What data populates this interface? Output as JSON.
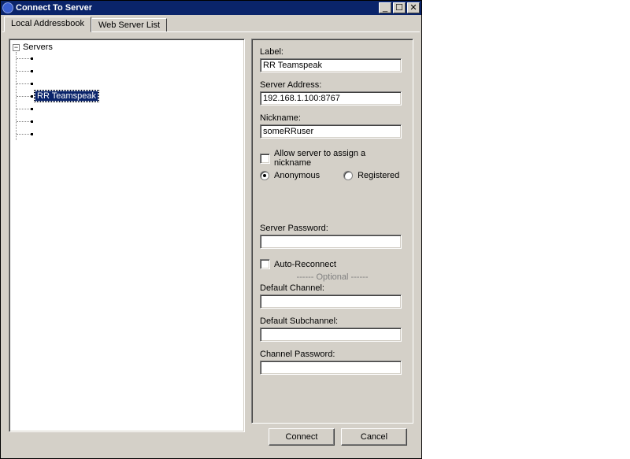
{
  "window": {
    "title": "Connect To Server"
  },
  "winbtns": {
    "min": "_",
    "max": "☐",
    "close": "✕"
  },
  "tabs": {
    "local": "Local Addressbook",
    "web": "Web Server List"
  },
  "tree": {
    "root": "Servers",
    "expander": "−",
    "selected": "RR Teamspeak"
  },
  "form": {
    "label_lbl": "Label:",
    "label_val": "RR Teamspeak",
    "addr_lbl": "Server Address:",
    "addr_val": "192.168.1.100:8767",
    "nick_lbl": "Nickname:",
    "nick_val": "someRRuser",
    "allow_assign": "Allow server to assign a nickname",
    "anon": "Anonymous",
    "reg": "Registered",
    "srvpwd_lbl": "Server Password:",
    "srvpwd_val": "",
    "autoreconnect": "Auto-Reconnect",
    "optional": "------ Optional ------",
    "defch_lbl": "Default Channel:",
    "defch_val": "",
    "defsub_lbl": "Default Subchannel:",
    "defsub_val": "",
    "chpwd_lbl": "Channel Password:",
    "chpwd_val": ""
  },
  "buttons": {
    "connect": "Connect",
    "cancel": "Cancel"
  }
}
